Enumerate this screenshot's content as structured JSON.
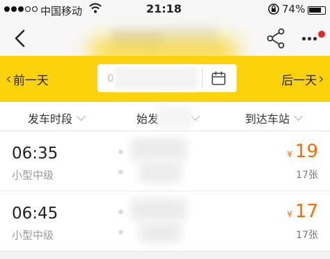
{
  "status_bar": {
    "carrier": "中国移动",
    "time": "21:18",
    "battery_pct": "74%",
    "wifi_icon": "wifi-icon",
    "lock_icon": "orientation-lock-icon"
  },
  "nav": {
    "back_icon": "chevron-left-icon",
    "share_icon": "share-icon",
    "more_icon": "more-dots-icon",
    "badge_color": "#e8232c"
  },
  "date_bar": {
    "prev_label": "前一天",
    "next_label": "后一天",
    "date_value": "0",
    "calendar_icon": "calendar-icon",
    "background_color": "#fcd20c"
  },
  "filters": [
    {
      "label": "发车时段"
    },
    {
      "label": "始发"
    },
    {
      "label": "到达车站"
    }
  ],
  "trips": [
    {
      "time": "06:35",
      "bus_type": "小型中级",
      "currency": "¥",
      "price": "19",
      "seats": "17张"
    },
    {
      "time": "06:45",
      "bus_type": "小型中级",
      "currency": "¥",
      "price": "17",
      "seats": "17张"
    }
  ],
  "colors": {
    "price": "#ff6a00",
    "accent": "#fcd20c"
  }
}
